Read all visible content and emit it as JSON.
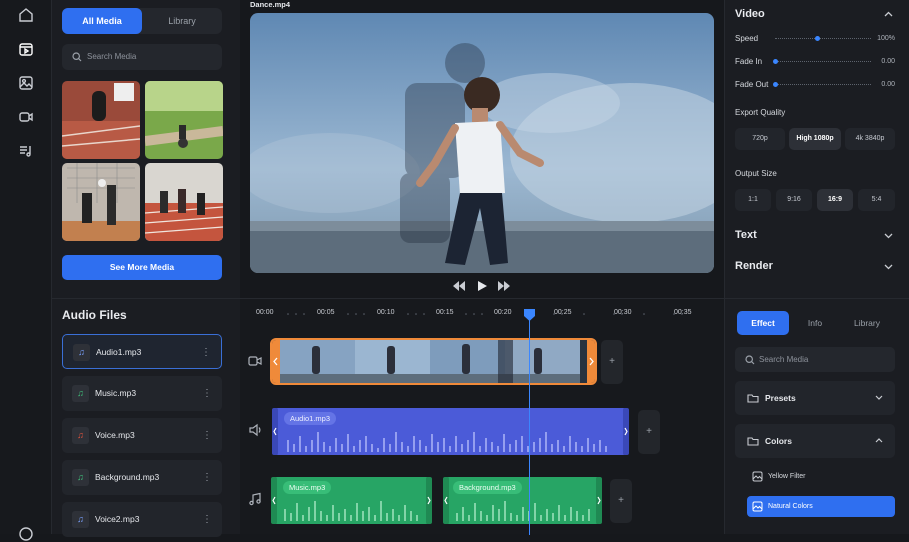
{
  "media": {
    "tabs": [
      {
        "label": "All Media",
        "active": true
      },
      {
        "label": "Library",
        "active": false
      }
    ],
    "search_placeholder": "Search Media",
    "see_more": "See More Media"
  },
  "preview": {
    "file_name": "Dance.mp4"
  },
  "video_panel": {
    "title": "Video",
    "speed_label": "Speed",
    "speed_value": "100%",
    "fade_in_label": "Fade In",
    "fade_in_value": "0.00",
    "fade_out_label": "Fade Out",
    "fade_out_value": "0.00",
    "export_quality_label": "Export Quality",
    "qualities": [
      "720p",
      "High 1080p",
      "4k 3840p"
    ],
    "selected_quality": "High 1080p",
    "output_size_label": "Output Size",
    "sizes": [
      "1:1",
      "9:16",
      "16:9",
      "5:4"
    ],
    "selected_size": "16:9",
    "text_section": "Text",
    "render_section": "Render"
  },
  "audio": {
    "title": "Audio Files",
    "files": [
      "Audio1.mp3",
      "Music.mp3",
      "Voice.mp3",
      "Background.mp3",
      "Voice2.mp3"
    ]
  },
  "timeline": {
    "ticks": [
      "00:00",
      "00:05",
      "00:10",
      "00:15",
      "00:20",
      "00:25",
      "00:30",
      "00:35"
    ],
    "playhead": "00:20",
    "audio_clip": "Audio1.mp3",
    "music_clips": [
      "Music.mp3",
      "Background.mp3"
    ]
  },
  "effects": {
    "tabs": [
      {
        "label": "Effect",
        "active": true
      },
      {
        "label": "Info",
        "active": false
      },
      {
        "label": "Library",
        "active": false
      }
    ],
    "search_placeholder": "Search Media",
    "presets": "Presets",
    "colors": "Colors",
    "filters": [
      "Yellow Filter",
      "Natural Colors"
    ],
    "selected_filter": "Natural Colors"
  },
  "colors": {
    "accent": "#2f6ff0",
    "audio_track": "#4b5bd8",
    "music_track": "#27a565",
    "video_border": "#ef8a3a"
  }
}
